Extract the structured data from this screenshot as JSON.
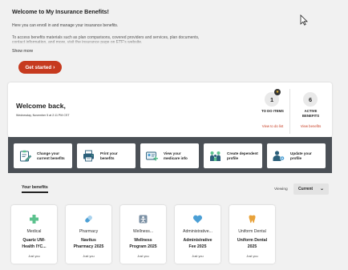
{
  "intro": {
    "title": "Welcome to My Insurance Benefits!",
    "paragraph1": "Here you can enroll in and manage your insurance benefits.",
    "paragraph2": "To access benefits materials such as plan comparisons, covered providers and services, plan documents, contact information, and more, visit the insurance page on ETF's website.",
    "show_more": "Show more",
    "get_started": "Get started"
  },
  "welcome": {
    "title": "Welcome back,",
    "date": "Wednesday, November 5 at 2:11 PM CST",
    "todo": {
      "count": "1",
      "label": "TO DO ITEMS",
      "link": "View to do list"
    },
    "active": {
      "count": "6",
      "label_line1": "ACTIVE",
      "label_line2": "BENEFITS",
      "link": "View benefits"
    }
  },
  "actions": [
    {
      "line1": "Change your",
      "line2": "current benefits",
      "icon": "clipboard-edit-icon"
    },
    {
      "line1": "Print your",
      "line2": "benefits",
      "icon": "printer-icon"
    },
    {
      "line1": "View your",
      "line2": "medicare info",
      "icon": "medicare-card-icon"
    },
    {
      "line1": "Create dependent",
      "line2": "profile",
      "icon": "family-icon"
    },
    {
      "line1": "Update your",
      "line2": "profile",
      "icon": "user-settings-icon"
    }
  ],
  "tabs": {
    "your_benefits": "Your benefits"
  },
  "viewing": {
    "label": "Viewing",
    "selected": "Current"
  },
  "benefits": [
    {
      "category": "Medical",
      "name_line1": "Quartz UW-",
      "name_line2": "Health IYC...",
      "footer": "Just you",
      "icon": "medical-cross-icon",
      "color": "#5cc28e"
    },
    {
      "category": "Pharmacy",
      "name_line1": "Navitus",
      "name_line2": "Pharmacy 2025",
      "footer": "Just you",
      "icon": "pill-icon",
      "color": "#4b9fd5"
    },
    {
      "category": "Wellness...",
      "name_line1": "Wellness",
      "name_line2": "Program 2025",
      "footer": "Just you",
      "icon": "wellness-icon",
      "color": "#7a8fa3"
    },
    {
      "category": "Administrative...",
      "name_line1": "Administrative",
      "name_line2": "Fee 2025",
      "footer": "Just you",
      "icon": "heart-icon",
      "color": "#4b9fd5"
    },
    {
      "category": "Uniform Dental",
      "name_line1": "Uniform Dental",
      "name_line2": "2025",
      "footer": "Just you",
      "icon": "tooth-icon",
      "color": "#e8a23a"
    }
  ],
  "colors": {
    "accent": "#c63a1f",
    "band": "#4b5056",
    "background": "#f1f1f1"
  }
}
